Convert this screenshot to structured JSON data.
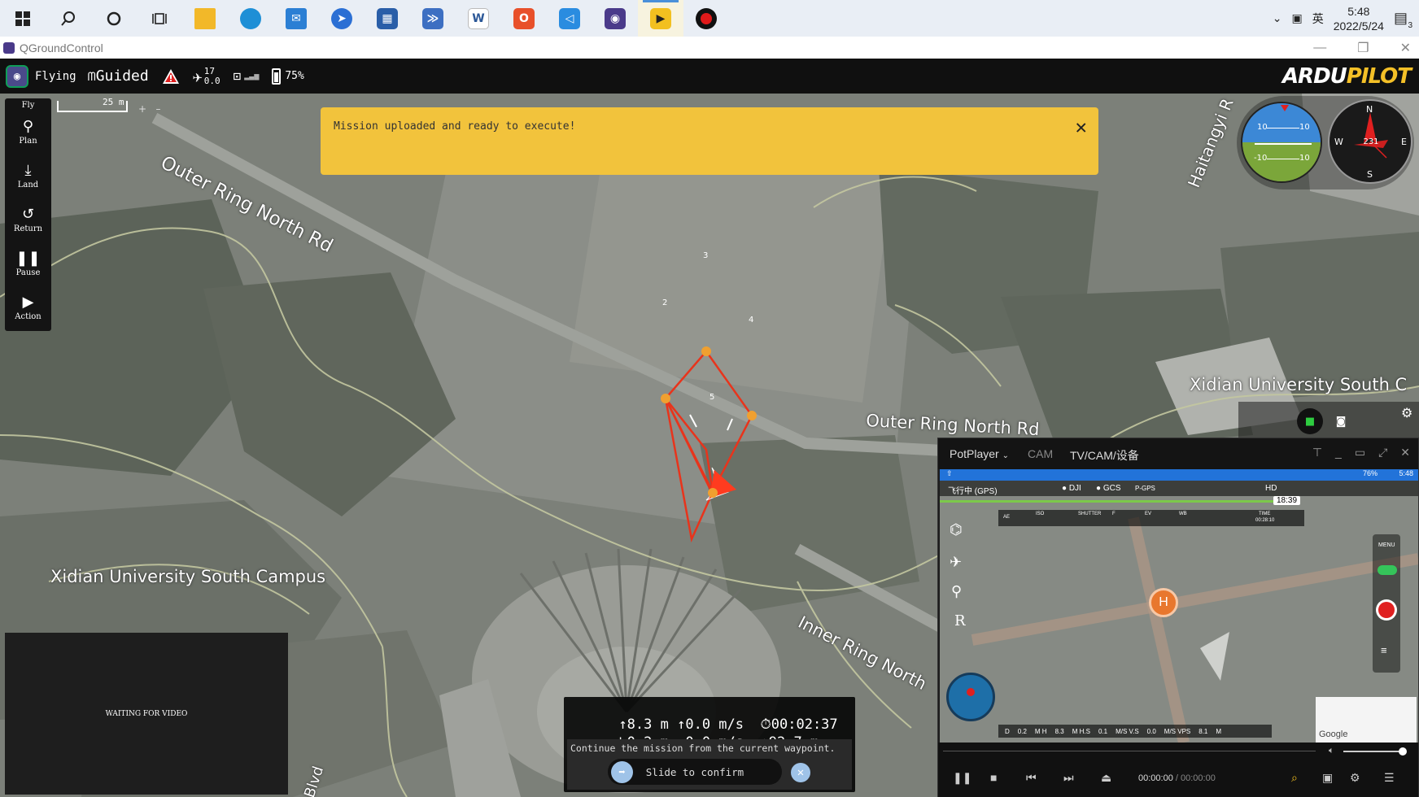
{
  "taskbar": {
    "clock_time": "5:48",
    "clock_date": "2022/5/24",
    "ime": "英",
    "notif_count": "3"
  },
  "window": {
    "title": "QGroundControl"
  },
  "toolbar": {
    "flight_status": "Flying",
    "flight_mode": "Guided",
    "sat_count": "17",
    "hdop": "0.0",
    "battery": "75%",
    "logo_text_a": "ARDU",
    "logo_text_b": "PILOT"
  },
  "fly_tools": {
    "header": "Fly",
    "items": [
      {
        "label": "Plan",
        "icon": "plan-icon"
      },
      {
        "label": "Land",
        "icon": "land-icon"
      },
      {
        "label": "Return",
        "icon": "return-icon"
      },
      {
        "label": "Pause",
        "icon": "pause-icon"
      },
      {
        "label": "Action",
        "icon": "action-icon"
      }
    ]
  },
  "map": {
    "scale_label": "25 m",
    "labels": {
      "outer_ring_north_1": "Outer Ring North Rd",
      "outer_ring_north_2": "Outer Ring North Rd",
      "haitangyi": "Haitangyi R",
      "xidian_south_left": "Xidian University South Campus",
      "xidian_south_right": "Xidian University South C",
      "inner_ring_north": "Inner Ring North",
      "blvd": "Blvd"
    },
    "waypoints": [
      "2",
      "3",
      "4",
      "5"
    ]
  },
  "notification": {
    "text": "Mission uploaded and ready to execute!"
  },
  "instruments": {
    "pitch_upper_left": "10",
    "pitch_upper_right": "10",
    "pitch_lower_left": "-10",
    "pitch_lower_right": "10",
    "compass_n": "N",
    "compass_s": "S",
    "compass_e": "E",
    "compass_w": "W",
    "heading": "231"
  },
  "video": {
    "waiting_text": "WAITING FOR VIDEO"
  },
  "telemetry": {
    "altitude": "8.3 m",
    "vertical_speed": "0.0 m/s",
    "flight_time": "00:02:37",
    "distance": "0.2 m",
    "horizontal_speed": "0.0 m/s",
    "distance_to_home": "92.7 m",
    "confirm_prompt": "Continue the mission from the current waypoint.",
    "slider_label": "Slide to confirm"
  },
  "potplayer": {
    "tab_main": "PotPlayer",
    "tab_cam": "CAM",
    "tab_device": "TV/CAM/设备",
    "dji": {
      "status": "飞行中 (GPS)",
      "dji_label": "DJI",
      "gcs_label": "GCS",
      "pgps_label": "P-GPS",
      "battery": "76%",
      "clock": "5:48",
      "hd": "HD",
      "flight_time": "18:39",
      "ae": "AE",
      "iso": "ISO",
      "shutter": "SHUTTER",
      "fnum": "F",
      "ev": "EV",
      "wb": "WB",
      "time": "TIME",
      "rec_time": "00:28:10",
      "menu": "MENU",
      "d_label": "D",
      "d_val": "0.2",
      "h_label": "M H",
      "h_val": "8.3",
      "hs_label": "M  H.S",
      "hs_val": "0.1",
      "vs_label": "M/S  V.S",
      "vs_val": "0.0",
      "vps_label": "M/S  VPS",
      "vps_val": "8.1",
      "vps_unit": "M",
      "google": "Google",
      "heli": "H",
      "r_label": "R"
    },
    "time_current": "00:00:00",
    "time_total": "/ 00:00:00"
  }
}
